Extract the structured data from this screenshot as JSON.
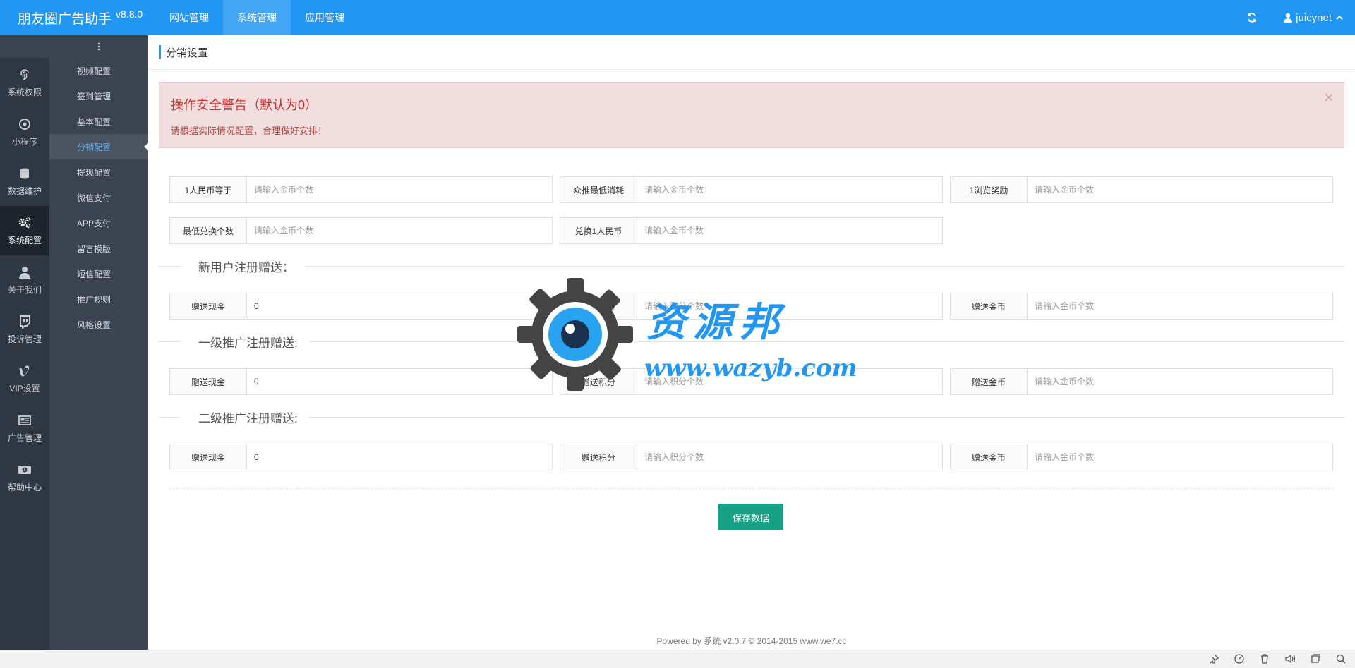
{
  "app": {
    "title": "朋友圈广告助手",
    "version": "v8.8.0"
  },
  "topnav": [
    {
      "label": "网站管理",
      "active": false
    },
    {
      "label": "系统管理",
      "active": true
    },
    {
      "label": "应用管理",
      "active": false
    }
  ],
  "user": {
    "name": "juicynet"
  },
  "iconbar": [
    {
      "label": "系统权限",
      "icon": "fingerprint-icon",
      "active": false
    },
    {
      "label": "小程序",
      "icon": "target-icon",
      "active": false
    },
    {
      "label": "数据维护",
      "icon": "database-icon",
      "active": false
    },
    {
      "label": "系统配置",
      "icon": "gears-icon",
      "active": true
    },
    {
      "label": "关于我们",
      "icon": "user-icon",
      "active": false
    },
    {
      "label": "投诉管理",
      "icon": "chat-icon",
      "active": false
    },
    {
      "label": "VIP设置",
      "icon": "vimeo-icon",
      "active": false
    },
    {
      "label": "广告管理",
      "icon": "newspaper-icon",
      "active": false
    },
    {
      "label": "帮助中心",
      "icon": "cash-icon",
      "active": false
    }
  ],
  "submenu": [
    {
      "label": "视频配置",
      "active": false
    },
    {
      "label": "签到管理",
      "active": false
    },
    {
      "label": "基本配置",
      "active": false
    },
    {
      "label": "分销配置",
      "active": true
    },
    {
      "label": "提现配置",
      "active": false
    },
    {
      "label": "微信支付",
      "active": false
    },
    {
      "label": "APP支付",
      "active": false
    },
    {
      "label": "留言模版",
      "active": false
    },
    {
      "label": "短信配置",
      "active": false
    },
    {
      "label": "推广规则",
      "active": false
    },
    {
      "label": "风格设置",
      "active": false
    }
  ],
  "page": {
    "title": "分销设置"
  },
  "alert": {
    "title": "操作安全警告（默认为0）",
    "text": "请根据实际情况配置，合理做好安排！"
  },
  "settings": {
    "row1": [
      {
        "label": "1人民币等于",
        "value": "",
        "placeholder": "请输入金币个数"
      },
      {
        "label": "众推最低消耗",
        "value": "",
        "placeholder": "请输入金币个数"
      },
      {
        "label": "1浏览奖励",
        "value": "",
        "placeholder": "请输入金币个数"
      }
    ],
    "row2": [
      {
        "label": "最低兑换个数",
        "value": "",
        "placeholder": "请输入金币个数"
      },
      {
        "label": "兑换1人民币",
        "value": "",
        "placeholder": "请输入金币个数"
      }
    ]
  },
  "sections": [
    {
      "title": "新用户注册赠送：",
      "fields": [
        {
          "label": "赠送现金",
          "value": "0",
          "placeholder": ""
        },
        {
          "label": "赠送积分",
          "value": "",
          "placeholder": "请输入积分个数"
        },
        {
          "label": "赠送金币",
          "value": "",
          "placeholder": "请输入金币个数"
        }
      ]
    },
    {
      "title": "一级推广注册赠送:",
      "fields": [
        {
          "label": "赠送现金",
          "value": "0",
          "placeholder": ""
        },
        {
          "label": "赠送积分",
          "value": "",
          "placeholder": "请输入积分个数"
        },
        {
          "label": "赠送金币",
          "value": "",
          "placeholder": "请输入金币个数"
        }
      ]
    },
    {
      "title": "二级推广注册赠送:",
      "fields": [
        {
          "label": "赠送现金",
          "value": "0",
          "placeholder": ""
        },
        {
          "label": "赠送积分",
          "value": "",
          "placeholder": "请输入积分个数"
        },
        {
          "label": "赠送金币",
          "value": "",
          "placeholder": "请输入金币个数"
        }
      ]
    }
  ],
  "save_label": "保存数据",
  "footer": "Powered by 系统 v2.0.7 © 2014-2015 www.we7.cc",
  "watermark": {
    "name": "资源邦",
    "url": "www.wazyb.com"
  },
  "colors": {
    "primary": "#2196f3",
    "sidebar": "#2f3742",
    "submenu": "#3a434f",
    "save": "#16a085",
    "alert_bg": "#f2dede",
    "alert_text": "#a94442"
  }
}
